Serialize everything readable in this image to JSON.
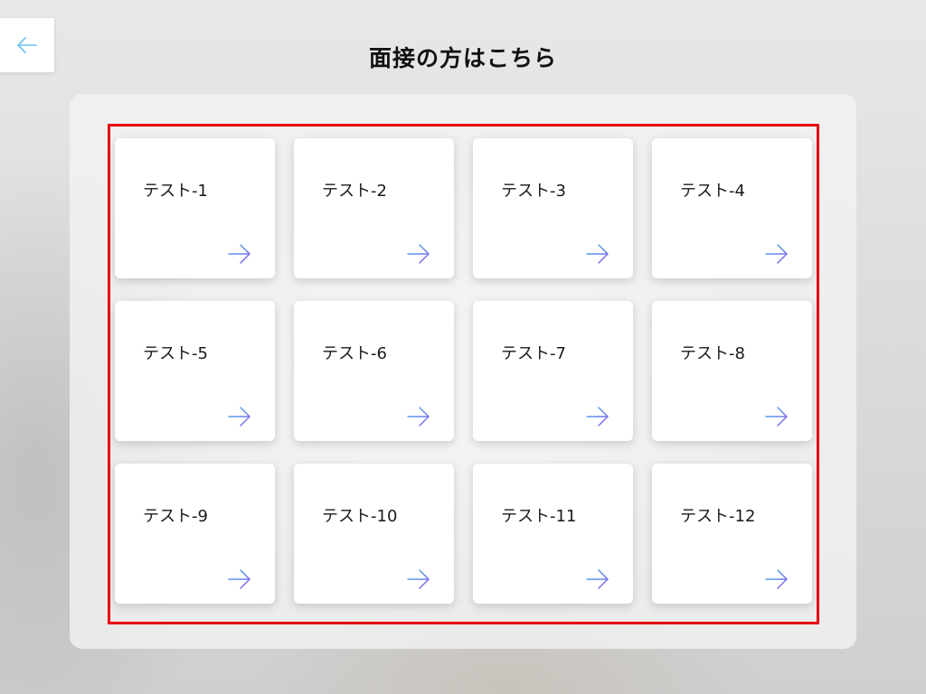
{
  "header": {
    "title": "面接の方はこちら",
    "back_icon": "arrow-left-icon"
  },
  "cards": [
    {
      "label": "テスト-1",
      "icon": "arrow-right-icon"
    },
    {
      "label": "テスト-2",
      "icon": "arrow-right-icon"
    },
    {
      "label": "テスト-3",
      "icon": "arrow-right-icon"
    },
    {
      "label": "テスト-4",
      "icon": "arrow-right-icon"
    },
    {
      "label": "テスト-5",
      "icon": "arrow-right-icon"
    },
    {
      "label": "テスト-6",
      "icon": "arrow-right-icon"
    },
    {
      "label": "テスト-7",
      "icon": "arrow-right-icon"
    },
    {
      "label": "テスト-8",
      "icon": "arrow-right-icon"
    },
    {
      "label": "テスト-9",
      "icon": "arrow-right-icon"
    },
    {
      "label": "テスト-10",
      "icon": "arrow-right-icon"
    },
    {
      "label": "テスト-11",
      "icon": "arrow-right-icon"
    },
    {
      "label": "テスト-12",
      "icon": "arrow-right-icon"
    }
  ],
  "colors": {
    "highlight_border": "#e60012",
    "arrow_gradient_start": "#3fb6e6",
    "arrow_gradient_end": "#8a5cf0",
    "back_arrow": "#6cc4ec"
  }
}
